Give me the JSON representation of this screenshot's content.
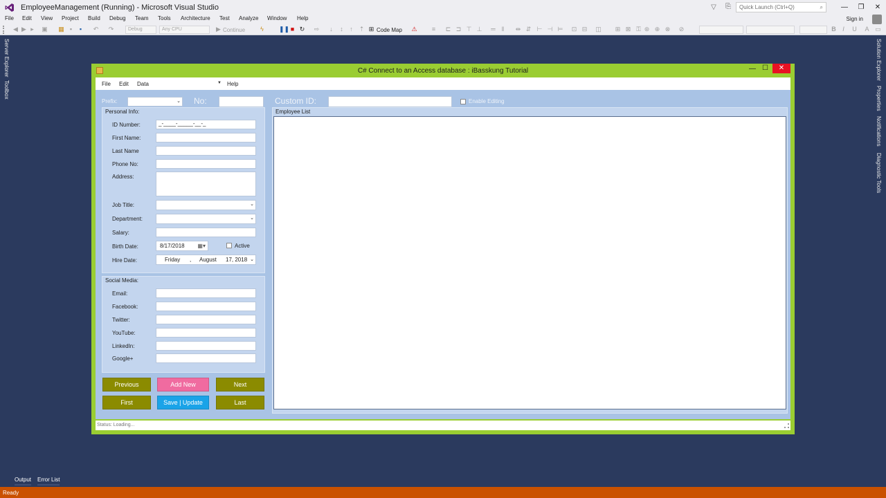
{
  "vs": {
    "title": "EmployeeManagement (Running) - Microsoft Visual Studio",
    "quick_launch_placeholder": "Quick Launch (Ctrl+Q)",
    "menu": [
      "File",
      "Edit",
      "View",
      "Project",
      "Build",
      "Debug",
      "Team",
      "Tools",
      "Architecture",
      "Test",
      "Analyze",
      "Window",
      "Help"
    ],
    "sign_in": "Sign in",
    "toolbar": {
      "config": "Debug",
      "platform": "Any CPU",
      "continue": "Continue",
      "code_map": "Code Map"
    },
    "left_tabs": [
      "Server Explorer",
      "Toolbox"
    ],
    "right_tabs": [
      "Solution Explorer",
      "Properties",
      "Notifications",
      "Diagnostic Tools"
    ],
    "bottom_tabs": [
      "Output",
      "Error List"
    ],
    "status": "Ready",
    "colors": {
      "status_bar": "#ca5100",
      "background": "#2b3a5e"
    }
  },
  "app": {
    "title": "C# Connect to an Access database : iBasskung Tutorial",
    "menu": {
      "file": "File",
      "edit": "Edit",
      "data": "Data",
      "help": "Help"
    },
    "top": {
      "prefix_label": "Prefix:",
      "no_label": "No:",
      "custom_id_label": "Custom ID:",
      "enable_editing_label": "Enable Editing"
    },
    "personal": {
      "title": "Personal Info:",
      "id_number_label": "ID Number:",
      "id_number_mask": "_-____-_____-__-_",
      "first_name_label": "First Name:",
      "last_name_label": "Last Name",
      "phone_label": "Phone No:",
      "address_label": "Address:",
      "job_title_label": "Job Title:",
      "department_label": "Department:",
      "salary_label": "Salary:",
      "birth_date_label": "Birth Date:",
      "birth_date_value": "8/17/2018",
      "active_label": "Active",
      "hire_date_label": "Hire Date:",
      "hire_date_day": "Friday",
      "hire_date_sep": ",",
      "hire_date_month": "August",
      "hire_date_rest": "17, 2018"
    },
    "social": {
      "title": "Social Media:",
      "email_label": "Email:",
      "facebook_label": "Facebook:",
      "twitter_label": "Twitter:",
      "youtube_label": "YouTube:",
      "linkedin_label": "LinkedIn:",
      "google_label": "Google+"
    },
    "buttons": {
      "previous": "Previous",
      "add_new": "Add New",
      "next": "Next",
      "first": "First",
      "save_update": "Save | Update",
      "last": "Last"
    },
    "employee_list_title": "Employee List",
    "status": "Status: Loading...",
    "colors": {
      "border": "#9acd32",
      "client": "#a9c3e5",
      "olive_button": "#8b8b00",
      "pink_button": "#f06ba0",
      "blue_button": "#1aa3e8"
    }
  }
}
